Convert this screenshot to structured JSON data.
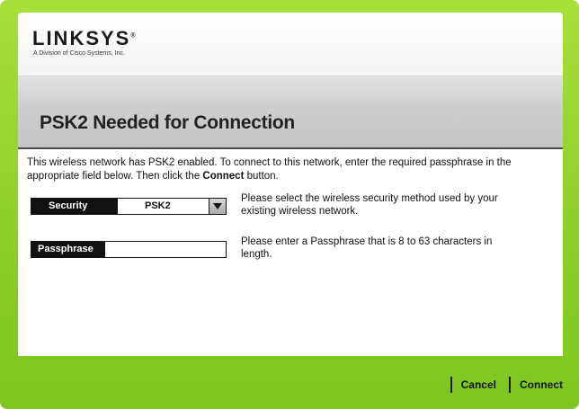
{
  "brand": {
    "logo_text": "LINKSYS",
    "logo_registered": "®",
    "tagline": "A Division of Cisco Systems, Inc."
  },
  "header": {
    "title": "PSK2 Needed for Connection"
  },
  "intro": {
    "text_part1": "This wireless network has PSK2 enabled. To connect to this network, enter the required passphrase in the appropriate field below. Then click the ",
    "text_bold": "Connect",
    "text_part2": " button."
  },
  "form": {
    "security": {
      "label": "Security",
      "selected_value": "PSK2",
      "help": "Please select the wireless security method used by your existing wireless network."
    },
    "passphrase": {
      "label": "Passphrase",
      "value": "",
      "help": "Please enter a Passphrase that is 8 to 63 characters in length."
    }
  },
  "footer": {
    "cancel_label": "Cancel",
    "connect_label": "Connect"
  },
  "colors": {
    "accent_green": "#8fd12a",
    "label_black": "#111111",
    "band_gray": "#cfcfcf"
  }
}
